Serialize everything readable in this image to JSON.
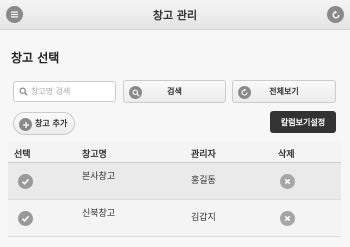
{
  "header": {
    "title": "창고 관리"
  },
  "page": {
    "title": "창고 선택"
  },
  "search": {
    "placeholder": "창고명 검색",
    "button_label": "검색"
  },
  "toolbar": {
    "view_all_label": "전체보기",
    "add_label": "창고 추가",
    "column_settings_label": "칼럼보기설정"
  },
  "table": {
    "columns": [
      "선택",
      "창고명",
      "관리자",
      "삭제"
    ],
    "rows": [
      {
        "name": "본사창고",
        "manager": "홍길동"
      },
      {
        "name": "신북창고",
        "manager": "김갑지"
      }
    ]
  },
  "icons": {
    "menu": "menu-icon",
    "back": "back-icon",
    "search": "search-icon",
    "refresh": "refresh-icon",
    "plus": "plus-icon",
    "check": "check-icon",
    "delete": "delete-icon"
  },
  "colors": {
    "icon_gray": "#8a8a8a",
    "dark_button": "#333333",
    "header_bg": "#eeeeee"
  }
}
